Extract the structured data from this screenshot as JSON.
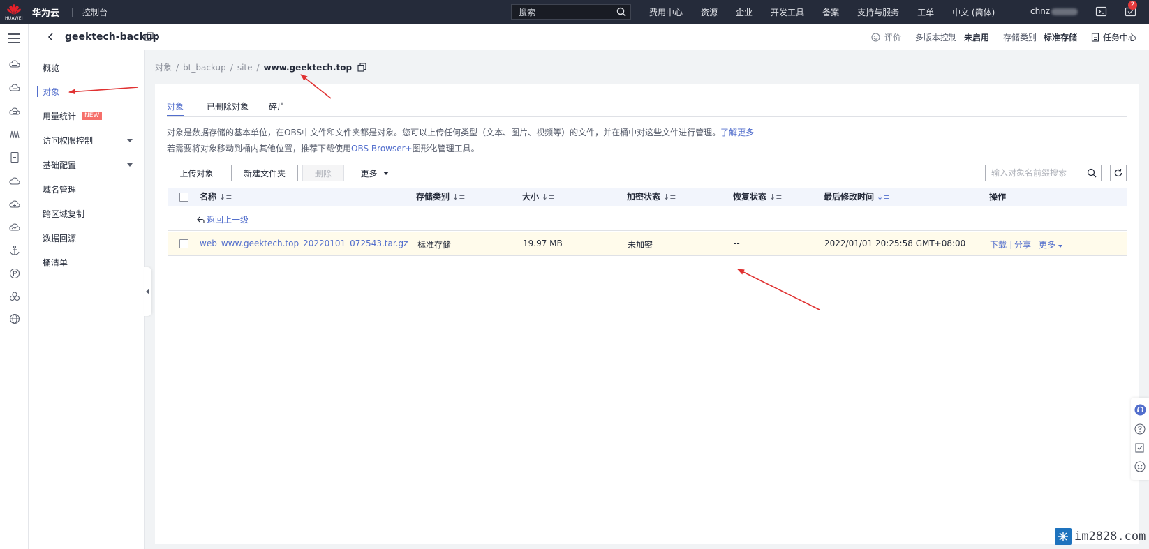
{
  "topbar": {
    "logo_text": "HUAWEI",
    "brand": "华为云",
    "console": "控制台",
    "search_placeholder": "搜索",
    "nav": [
      "费用中心",
      "资源",
      "企业",
      "开发工具",
      "备案",
      "支持与服务",
      "工单",
      "中文 (简体)"
    ],
    "user": "chnz",
    "notification_count": "2"
  },
  "header": {
    "bucket_name": "geektech-backup",
    "feedback": "评价",
    "versioning_label": "多版本控制",
    "versioning_value": "未启用",
    "storage_label": "存储类别",
    "storage_value": "标准存储",
    "task_center": "任务中心"
  },
  "sidebar": {
    "items": [
      {
        "label": "概览"
      },
      {
        "label": "对象"
      },
      {
        "label": "用量统计",
        "badge": "NEW"
      },
      {
        "label": "访问权限控制"
      },
      {
        "label": "基础配置"
      },
      {
        "label": "域名管理"
      },
      {
        "label": "跨区域复制"
      },
      {
        "label": "数据回源"
      },
      {
        "label": "桶清单"
      }
    ]
  },
  "breadcrumb": [
    "对象",
    "bt_backup",
    "site",
    "www.geektech.top"
  ],
  "tabs": [
    "对象",
    "已删除对象",
    "碎片"
  ],
  "description": {
    "line1": "对象是数据存储的基本单位，在OBS中文件和文件夹都是对象。您可以上传任何类型（文本、图片、视频等）的文件，并在桶中对这些文件进行管理。",
    "line1_link": "了解更多",
    "line2_prefix": "若需要将对象移动到桶内其他位置，推荐下载使用",
    "line2_link": "OBS Browser+",
    "line2_suffix": "图形化管理工具。"
  },
  "toolbar": {
    "upload": "上传对象",
    "new_folder": "新建文件夹",
    "delete": "删除",
    "more": "更多",
    "search_placeholder": "输入对象名前缀搜索"
  },
  "table": {
    "columns": [
      "名称",
      "存储类别",
      "大小",
      "加密状态",
      "恢复状态",
      "最后修改时间",
      "操作"
    ],
    "back_link": "返回上一级",
    "rows": [
      {
        "name": "web_www.geektech.top_20220101_072543.tar.gz",
        "storage": "标准存储",
        "size": "19.97 MB",
        "encryption": "未加密",
        "restore": "--",
        "modified": "2022/01/01 20:25:58 GMT+08:00",
        "ops": [
          "下载",
          "分享",
          "更多"
        ]
      }
    ]
  },
  "watermark": "im2828.com",
  "colors": {
    "topbar": "#252b3a",
    "accent": "#526ecc",
    "annotation": "#e03131",
    "row_highlight": "#fffbeb"
  }
}
